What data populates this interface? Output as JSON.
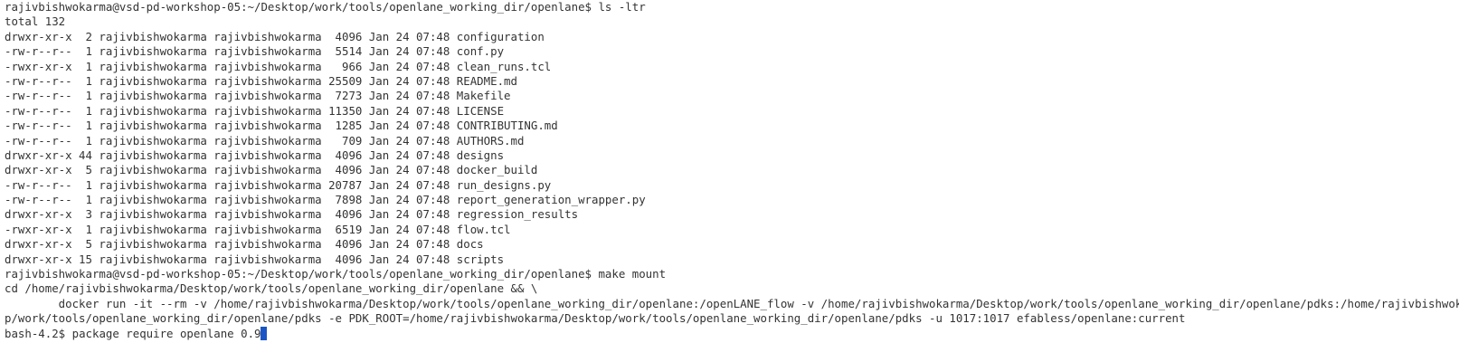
{
  "terminal": {
    "prompt_ls": "rajivbishwokarma@vsd-pd-workshop-05:~/Desktop/work/tools/openlane_working_dir/openlane$ ls -ltr",
    "total": "total 132",
    "files": [
      "drwxr-xr-x  2 rajivbishwokarma rajivbishwokarma  4096 Jan 24 07:48 configuration",
      "-rw-r--r--  1 rajivbishwokarma rajivbishwokarma  5514 Jan 24 07:48 conf.py",
      "-rwxr-xr-x  1 rajivbishwokarma rajivbishwokarma   966 Jan 24 07:48 clean_runs.tcl",
      "-rw-r--r--  1 rajivbishwokarma rajivbishwokarma 25509 Jan 24 07:48 README.md",
      "-rw-r--r--  1 rajivbishwokarma rajivbishwokarma  7273 Jan 24 07:48 Makefile",
      "-rw-r--r--  1 rajivbishwokarma rajivbishwokarma 11350 Jan 24 07:48 LICENSE",
      "-rw-r--r--  1 rajivbishwokarma rajivbishwokarma  1285 Jan 24 07:48 CONTRIBUTING.md",
      "-rw-r--r--  1 rajivbishwokarma rajivbishwokarma   709 Jan 24 07:48 AUTHORS.md",
      "drwxr-xr-x 44 rajivbishwokarma rajivbishwokarma  4096 Jan 24 07:48 designs",
      "drwxr-xr-x  5 rajivbishwokarma rajivbishwokarma  4096 Jan 24 07:48 docker_build",
      "-rw-r--r--  1 rajivbishwokarma rajivbishwokarma 20787 Jan 24 07:48 run_designs.py",
      "-rw-r--r--  1 rajivbishwokarma rajivbishwokarma  7898 Jan 24 07:48 report_generation_wrapper.py",
      "drwxr-xr-x  3 rajivbishwokarma rajivbishwokarma  4096 Jan 24 07:48 regression_results",
      "-rwxr-xr-x  1 rajivbishwokarma rajivbishwokarma  6519 Jan 24 07:48 flow.tcl",
      "drwxr-xr-x  5 rajivbishwokarma rajivbishwokarma  4096 Jan 24 07:48 docs",
      "drwxr-xr-x 15 rajivbishwokarma rajivbishwokarma  4096 Jan 24 07:48 scripts"
    ],
    "prompt_make": "rajivbishwokarma@vsd-pd-workshop-05:~/Desktop/work/tools/openlane_working_dir/openlane$ make mount",
    "cd_line": "cd /home/rajivbishwokarma/Desktop/work/tools/openlane_working_dir/openlane && \\",
    "docker_line1": "        docker run -it --rm -v /home/rajivbishwokarma/Desktop/work/tools/openlane_working_dir/openlane:/openLANE_flow -v /home/rajivbishwokarma/Desktop/work/tools/openlane_working_dir/openlane/pdks:/home/rajivbishwokarma/Deskto",
    "docker_line2": "p/work/tools/openlane_working_dir/openlane/pdks -e PDK_ROOT=/home/rajivbishwokarma/Desktop/work/tools/openlane_working_dir/openlane/pdks -u 1017:1017 efabless/openlane:current",
    "bash_prompt": "bash-4.2$ ",
    "bash_command": "package require openlane 0.9"
  },
  "colors": {
    "background": "#ffffff",
    "text": "#333333",
    "cursor": "#1a55c4"
  }
}
